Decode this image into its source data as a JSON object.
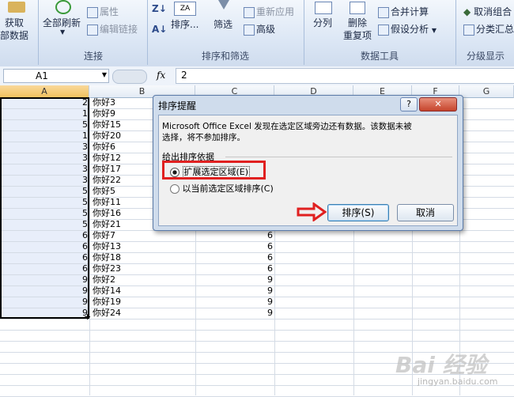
{
  "ribbon": {
    "get_data": [
      "获取",
      "部数据"
    ],
    "refresh_all": "全部刷新",
    "properties": "属性",
    "edit_links": "编辑链接",
    "sort_az": "Z↓",
    "sort_za": "A↓",
    "sort": "排序...",
    "filter": "筛选",
    "reapply": "重新应用",
    "advanced": "高级",
    "text_to_columns": "分列",
    "remove_duplicates": [
      "删除",
      "重复项"
    ],
    "consolidate": "合并计算",
    "what_if": "假设分析",
    "ungroup": "取消组合",
    "subtotal": "分类汇总",
    "group_connections": "连接",
    "group_sort_filter": "排序和筛选",
    "group_data_tools": "数据工具",
    "group_outline": "分级显示"
  },
  "formula_bar": {
    "name_box": "A1",
    "fx": "fx",
    "value": "2"
  },
  "columns": [
    "A",
    "B",
    "C",
    "D",
    "E",
    "F",
    "G"
  ],
  "rows": [
    {
      "a": "2",
      "b": "你好3",
      "c": ""
    },
    {
      "a": "1",
      "b": "你好9",
      "c": ""
    },
    {
      "a": "5",
      "b": "你好15",
      "c": ""
    },
    {
      "a": "1",
      "b": "你好20",
      "c": ""
    },
    {
      "a": "3",
      "b": "你好6",
      "c": ""
    },
    {
      "a": "3",
      "b": "你好12",
      "c": ""
    },
    {
      "a": "3",
      "b": "你好17",
      "c": ""
    },
    {
      "a": "3",
      "b": "你好22",
      "c": ""
    },
    {
      "a": "5",
      "b": "你好5",
      "c": ""
    },
    {
      "a": "5",
      "b": "你好11",
      "c": ""
    },
    {
      "a": "5",
      "b": "你好16",
      "c": ""
    },
    {
      "a": "5",
      "b": "你好21",
      "c": ""
    },
    {
      "a": "6",
      "b": "你好7",
      "c": "6"
    },
    {
      "a": "6",
      "b": "你好13",
      "c": "6"
    },
    {
      "a": "6",
      "b": "你好18",
      "c": "6"
    },
    {
      "a": "6",
      "b": "你好23",
      "c": "6"
    },
    {
      "a": "9",
      "b": "你好2",
      "c": "9"
    },
    {
      "a": "9",
      "b": "你好14",
      "c": "9"
    },
    {
      "a": "9",
      "b": "你好19",
      "c": "9"
    },
    {
      "a": "9",
      "b": "你好24",
      "c": "9"
    }
  ],
  "dialog": {
    "title": "排序提醒",
    "help": "?",
    "close": "✕",
    "message_line1": "Microsoft Office Excel 发现在选定区域旁边还有数据。该数据未被",
    "message_line2": "选择，将不参加排序。",
    "group_label": "给出排序依据",
    "option_expand": "扩展选定区域(E)",
    "option_current": "以当前选定区域排序(C)",
    "sort_button": "排序(S)",
    "cancel_button": "取消"
  },
  "watermark": "Bai 经验",
  "watermark_url": "jingyan.baidu.com",
  "colors": {
    "highlight_box": "#e02020",
    "arrow": "#e02020",
    "selection_fill": "#e8eefa"
  }
}
